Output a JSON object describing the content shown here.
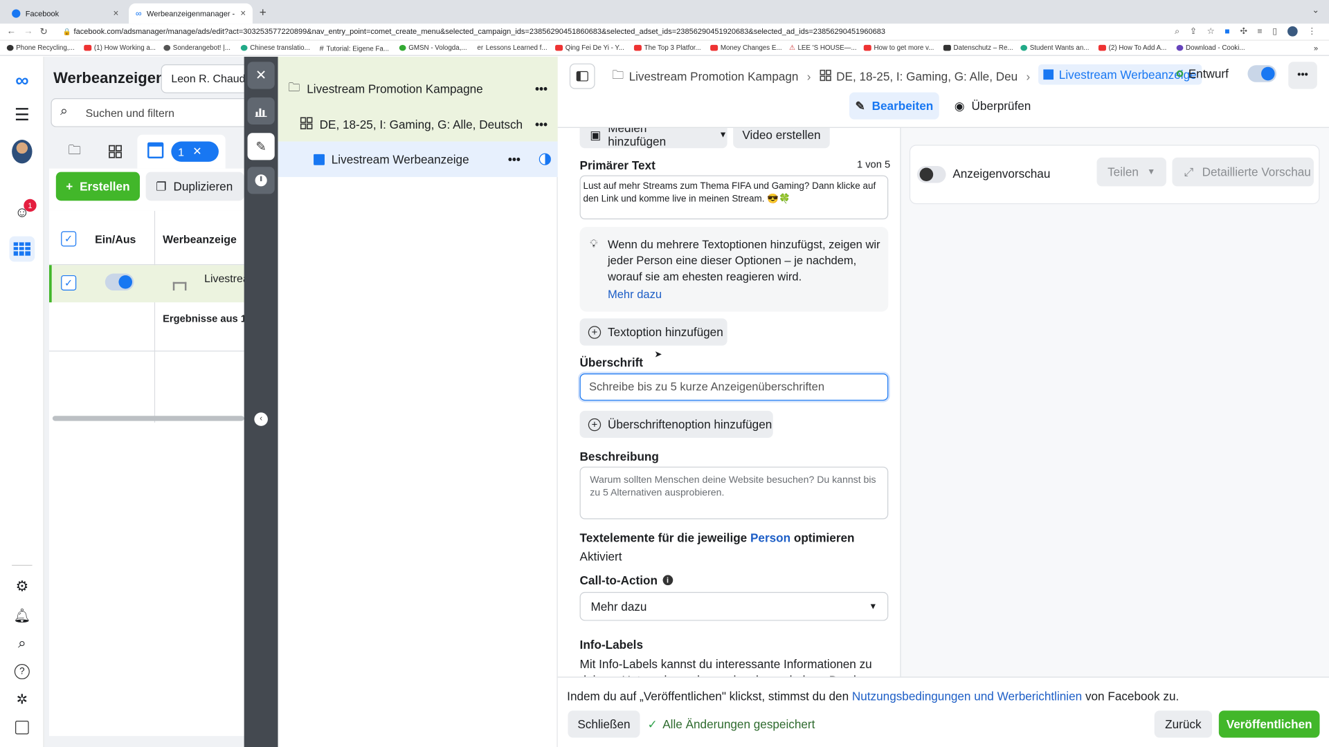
{
  "browser": {
    "tabs": [
      {
        "title": "Facebook"
      },
      {
        "title": "Werbeanzeigenmanager - Wer"
      }
    ],
    "url": "facebook.com/adsmanager/manage/ads/edit?act=303253577220899&nav_entry_point=comet_create_menu&selected_campaign_ids=23856290451860683&selected_adset_ids=23856290451920683&selected_ad_ids=23856290451960683",
    "bookmarks": [
      "Phone Recycling,...",
      "(1) How Working a...",
      "Sonderangebot! |...",
      "Chinese translatio...",
      "Tutorial: Eigene Fa...",
      "GMSN - Vologda,...",
      "Lessons Learned f...",
      "Qing Fei De Yi - Y...",
      "The Top 3 Platfor...",
      "Money Changes E...",
      "LEE 'S HOUSE—...",
      "How to get more v...",
      "Datenschutz – Re...",
      "Student Wants an...",
      "(2) How To Add A...",
      "Download - Cooki..."
    ]
  },
  "rail": {
    "notif_count": "1"
  },
  "left": {
    "title": "Werbeanzeigen",
    "account": "Leon R. Chaudh",
    "search_placeholder": "Suchen und filtern",
    "selected_count": "1",
    "create_label": "Erstellen",
    "duplicate_label": "Duplizieren",
    "col_onoff": "Ein/Aus",
    "col_ad": "Werbeanzeige",
    "row_name": "Livestrea",
    "results_label": "Ergebnisse aus 1"
  },
  "tree": {
    "campaign": "Livestream Promotion Kampagne",
    "adset": "DE, 18-25, I: Gaming, G: Alle, Deutsch",
    "ad": "Livestream Werbeanzeige"
  },
  "header": {
    "crumb_campaign": "Livestream Promotion Kampagn",
    "crumb_adset": "DE, 18-25, I: Gaming, G: Alle, Deu",
    "crumb_ad": "Livestream Werbeanzeige",
    "status": "Entwurf",
    "edit_tab": "Bearbeiten",
    "review_tab": "Überprüfen",
    "status_color": "#31a24c"
  },
  "form": {
    "media_button": "Medien hinzufügen",
    "video_button": "Video erstellen",
    "primary_label": "Primärer Text",
    "primary_count": "1 von 5",
    "primary_value": "Lust auf mehr Streams zum Thema FIFA und Gaming? Dann klicke auf den Link und komme live in meinen Stream. 😎🍀",
    "tip_text": "Wenn du mehrere Textoptionen hinzufügst, zeigen wir jeder Person eine dieser Optionen – je nachdem, worauf sie am ehesten reagieren wird.",
    "tip_link": "Mehr dazu",
    "add_text_option": "Textoption hinzufügen",
    "headline_label": "Überschrift",
    "headline_placeholder": "Schreibe bis zu 5 kurze Anzeigenüberschriften",
    "add_headline_option": "Überschriftenoption hinzufügen",
    "description_label": "Beschreibung",
    "description_placeholder": "Warum sollten Menschen deine Website besuchen? Du kannst bis zu 5 Alternativen ausprobieren.",
    "optimize_pre": "Textelemente für die jeweilige ",
    "optimize_link": "Person",
    "optimize_post": " optimieren",
    "optimize_value": "Aktiviert",
    "cta_label": "Call-to-Action",
    "cta_value": "Mehr dazu",
    "info_label": "Info-Labels",
    "info_text": "Mit Info-Labels kannst du interessante Informationen zu deinem Unternehmen besonders hervorheben. Das kann zum"
  },
  "preview": {
    "toggle_label": "Anzeigenvorschau",
    "share_label": "Teilen",
    "detail_label": "Detaillierte Vorschau"
  },
  "footer": {
    "notice_pre": "Indem du auf „Veröffentlichen\" klickst, stimmst du den ",
    "notice_link": "Nutzungsbedingungen und Werberichtlinien",
    "notice_post": " von Facebook zu.",
    "close": "Schließen",
    "saved": "Alle Änderungen gespeichert",
    "back": "Zurück",
    "publish": "Veröffentlichen"
  },
  "colors": {
    "accent": "#1877f2",
    "green": "#42b72a",
    "link": "#1d5ec6"
  }
}
